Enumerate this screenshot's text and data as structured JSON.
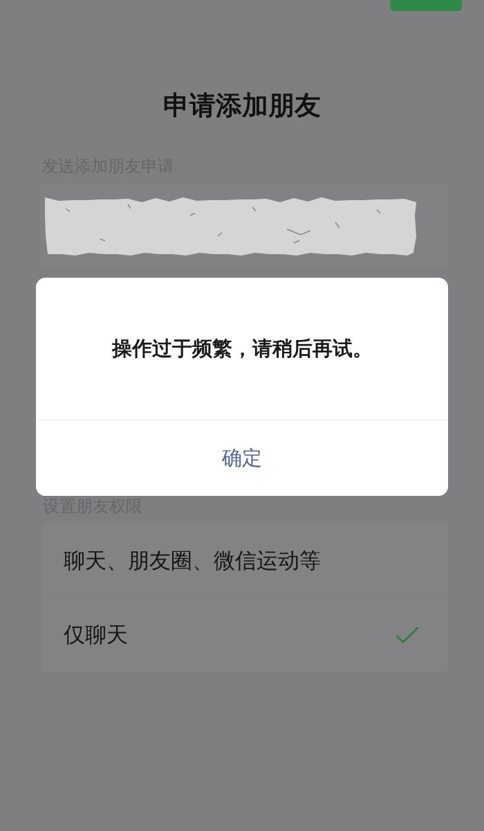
{
  "page": {
    "title": "申请添加朋友"
  },
  "request_section": {
    "label": "发送添加朋友申请"
  },
  "dialog": {
    "message": "操作过于频繁，请稍后再试。",
    "buttons": [
      "确定"
    ]
  },
  "permissions": {
    "label": "设置朋友权限",
    "options": [
      {
        "label": "聊天、朋友圈、微信运动等",
        "selected": false
      },
      {
        "label": "仅聊天",
        "selected": true
      }
    ]
  }
}
